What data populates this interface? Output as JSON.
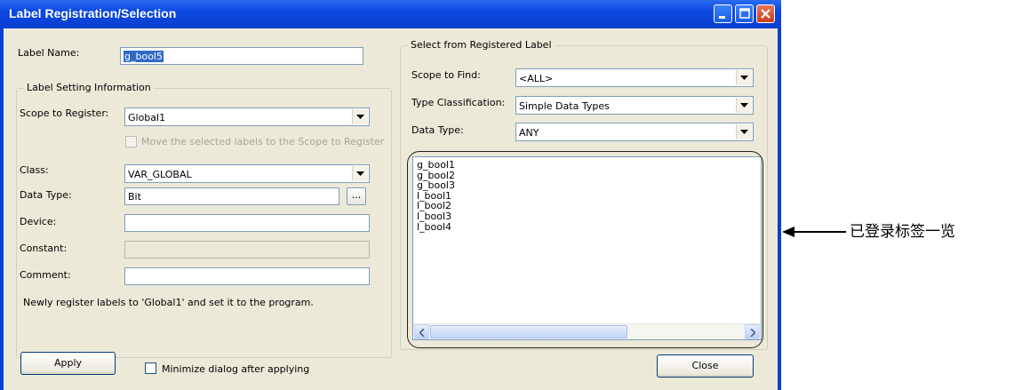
{
  "window": {
    "title": "Label Registration/Selection"
  },
  "label_name": {
    "label": "Label Name:",
    "value": "g_bool5"
  },
  "label_setting": {
    "group_title": "Label Setting Information",
    "scope_label": "Scope to Register:",
    "scope_value": "Global1",
    "move_checkbox_label": "Move the selected labels to the Scope to Register",
    "class_label": "Class:",
    "class_value": "VAR_GLOBAL",
    "data_type_label": "Data Type:",
    "data_type_value": "Bit",
    "browse_button": "...",
    "device_label": "Device:",
    "device_value": "",
    "constant_label": "Constant:",
    "constant_value": "",
    "comment_label": "Comment:",
    "comment_value": "",
    "info_text": "Newly register labels to 'Global1' and set it to the program."
  },
  "registered": {
    "group_title": "Select from Registered Label",
    "scope_find_label": "Scope to Find:",
    "scope_find_value": "<ALL>",
    "type_class_label": "Type Classification:",
    "type_class_value": "Simple Data Types",
    "data_type_label": "Data Type:",
    "data_type_value": "ANY",
    "items": [
      "g_bool1",
      "g_bool2",
      "g_bool3",
      "l_bool1",
      "l_bool2",
      "l_bool3",
      "l_bool4"
    ]
  },
  "footer": {
    "apply_button": "Apply",
    "minimize_checkbox_label": "Minimize dialog after applying",
    "close_button": "Close"
  },
  "annotation": {
    "text": "已登录标签一览"
  },
  "colors": {
    "title_bar": "#0a48e0",
    "dialog_background": "#ece9d8",
    "selection_highlight": "#316ac5",
    "close_button": "#c7401c"
  }
}
